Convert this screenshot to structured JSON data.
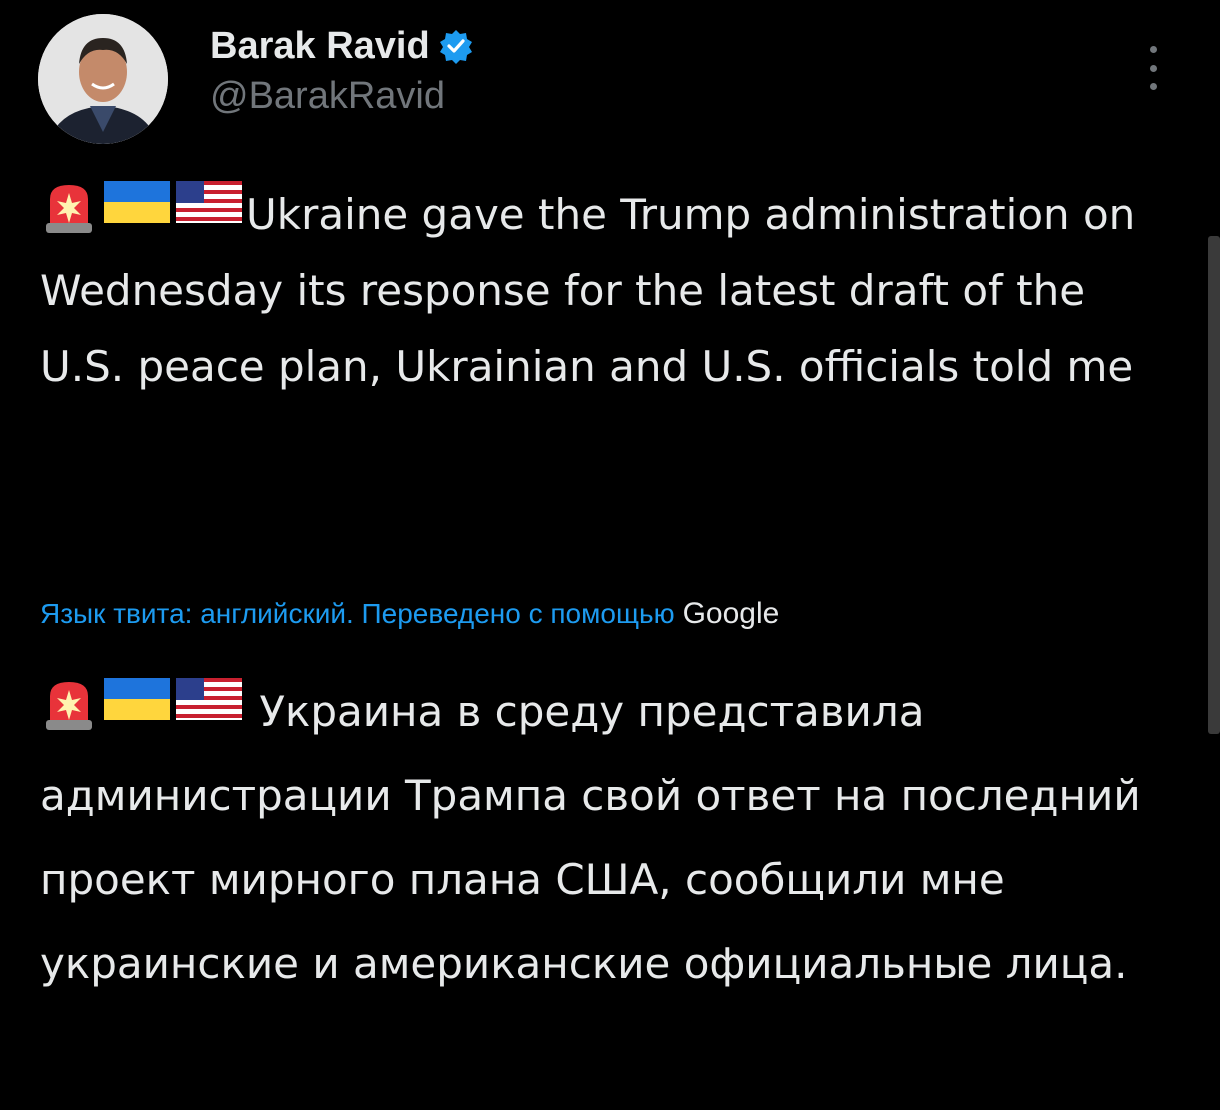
{
  "author": {
    "display_name": "Barak Ravid",
    "handle": "@BarakRavid",
    "verified_icon": "verified-badge-icon",
    "avatar_icon": "avatar"
  },
  "more_menu_icon": "more-vertical-icon",
  "tweet": {
    "emojis": [
      "rotating-light-icon",
      "ukraine-flag-icon",
      "usa-flag-icon"
    ],
    "text": "Ukraine gave the Trump administration on Wednesday its response for the latest draft of the U.S. peace plan, Ukrainian and U.S. officials told me"
  },
  "translation": {
    "note": "Язык твита: английский. Переведено с помощью",
    "provider": "Google",
    "emojis": [
      "rotating-light-icon",
      "ukraine-flag-icon",
      "usa-flag-icon"
    ],
    "text": "Украина в среду представила администрации Трампа свой ответ на последний проект мирного плана США, сообщили мне украинские и американские официальные лица."
  },
  "colors": {
    "background": "#000000",
    "text": "#E7E9EA",
    "secondary": "#71767B",
    "link": "#1D9BF0"
  }
}
